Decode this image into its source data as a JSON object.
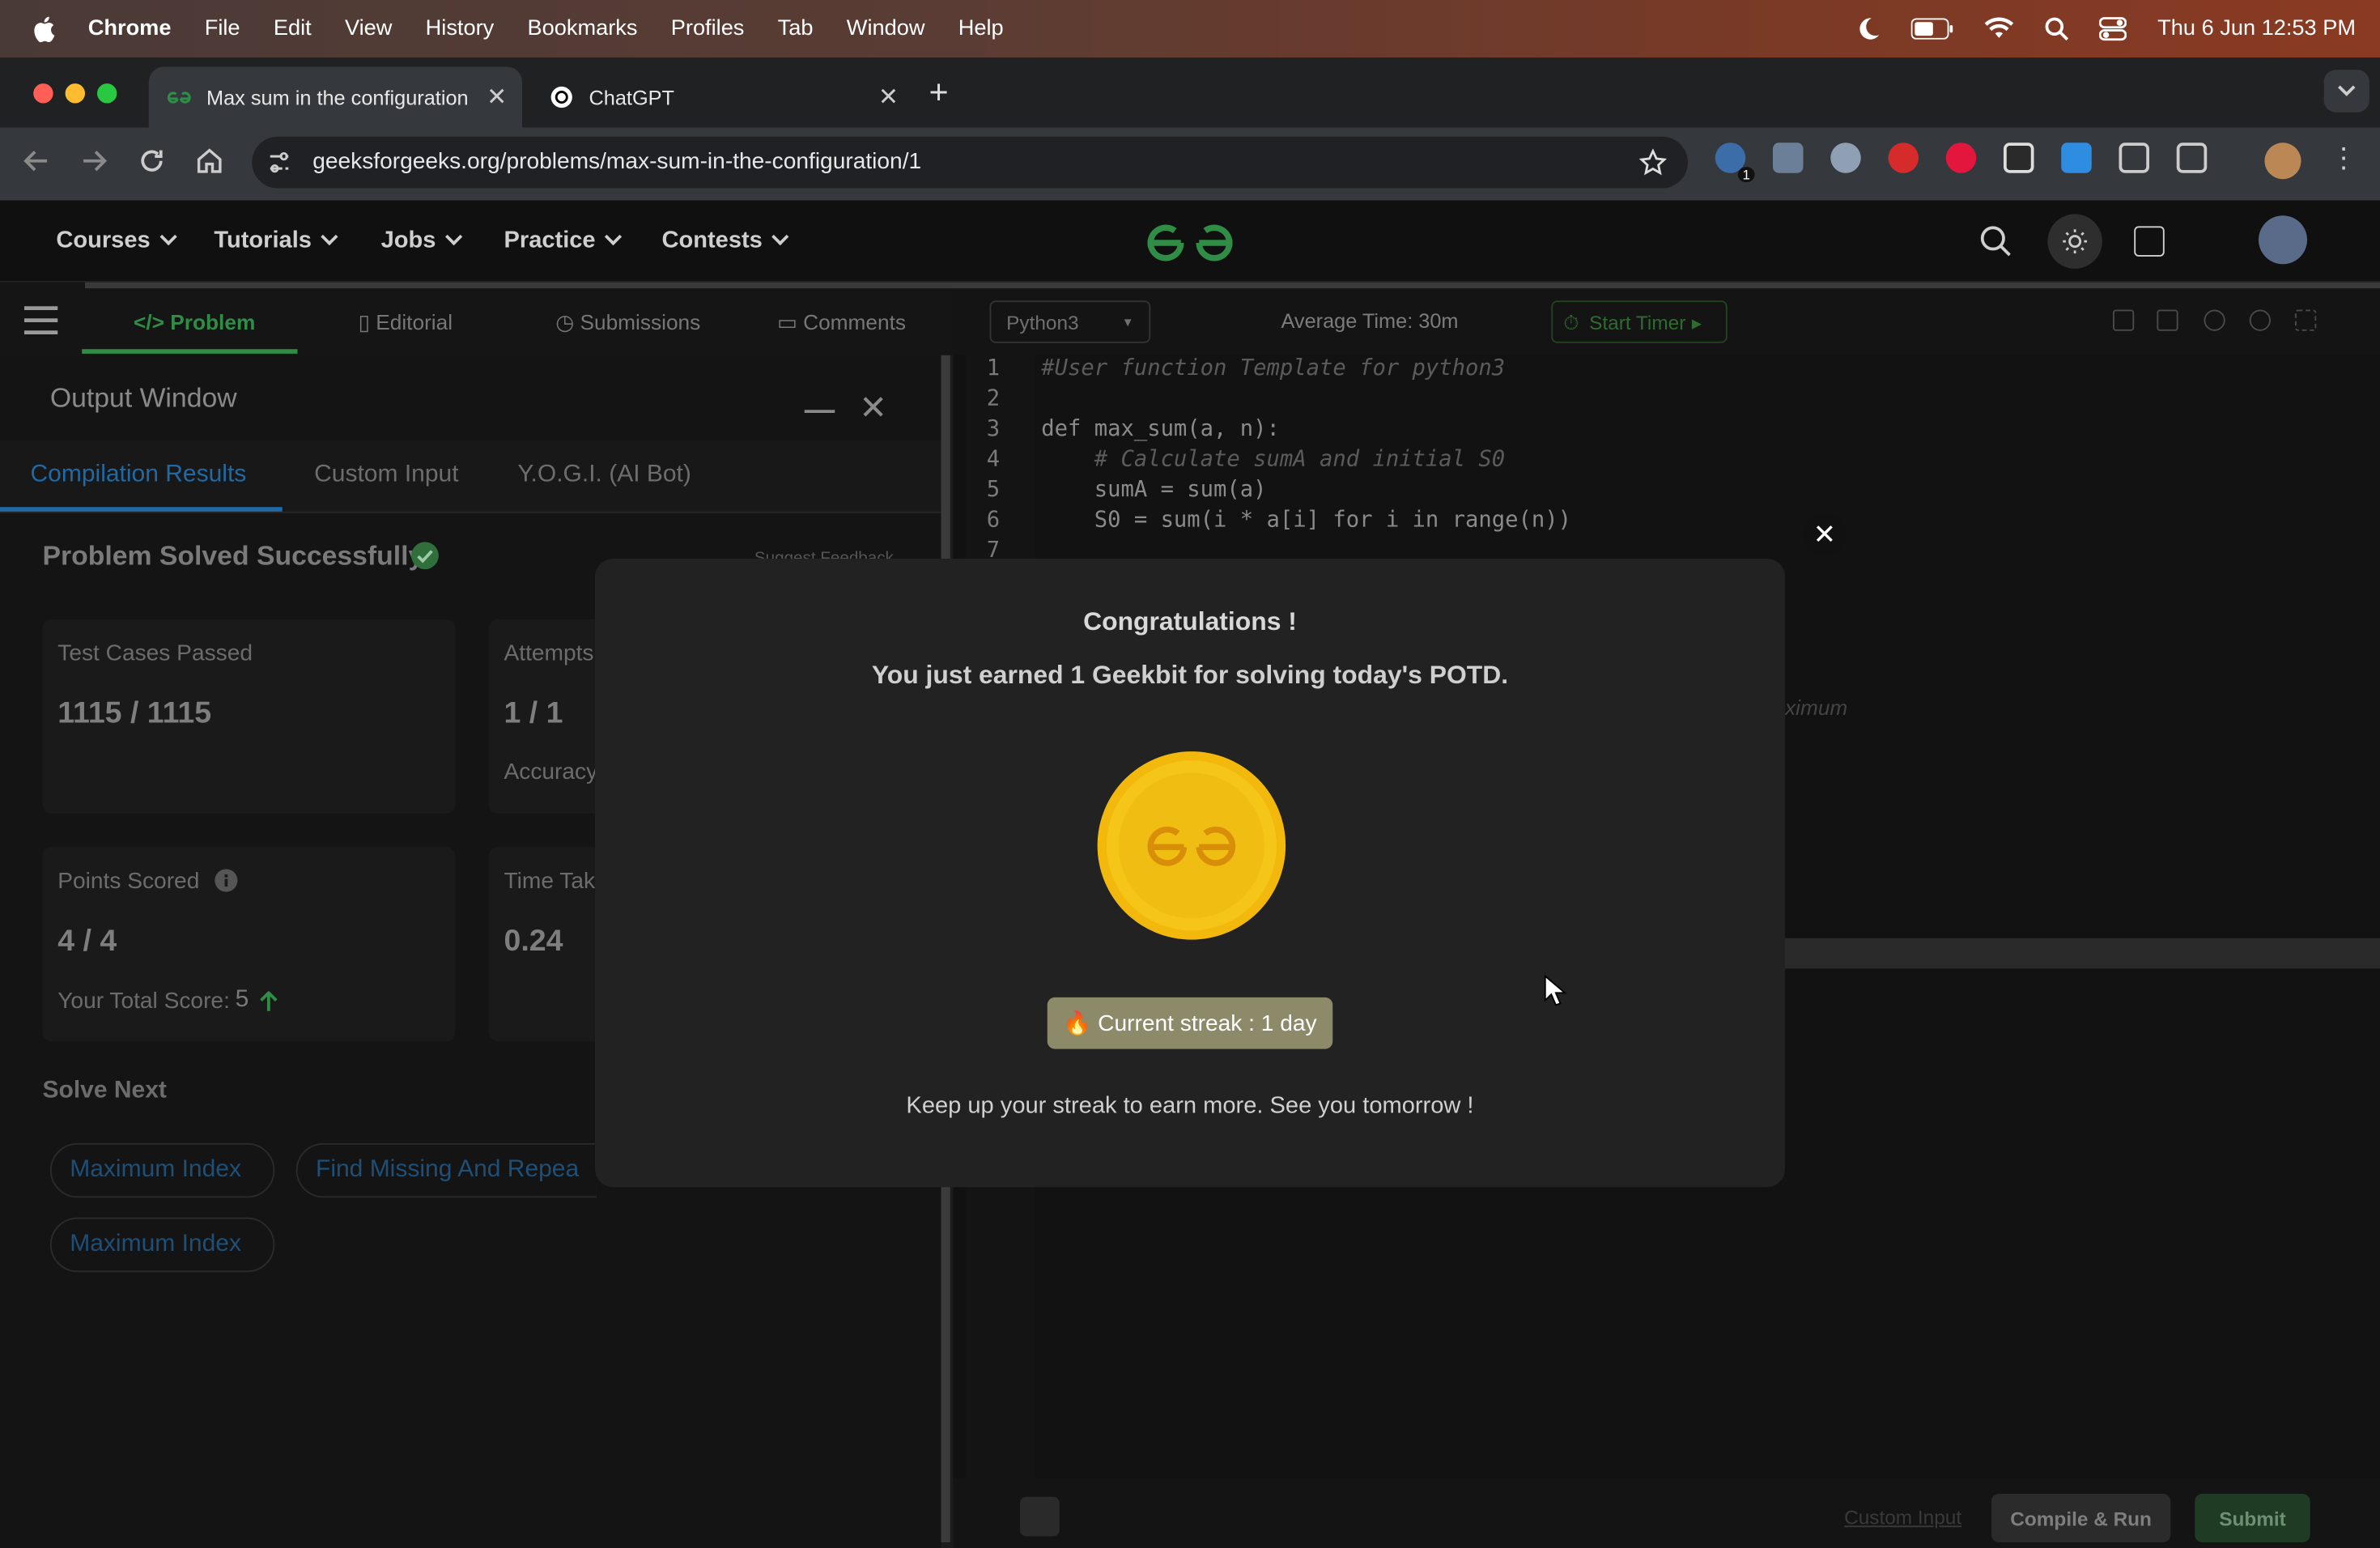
{
  "macbar": {
    "app": "Chrome",
    "menus": [
      "File",
      "Edit",
      "View",
      "History",
      "Bookmarks",
      "Profiles",
      "Tab",
      "Window",
      "Help"
    ],
    "datetime": "Thu 6 Jun  12:53 PM",
    "icons": [
      "apple-icon",
      "moon-icon",
      "battery-icon",
      "wifi-icon",
      "spotlight-icon",
      "control-center-icon"
    ]
  },
  "browser": {
    "tabs": [
      {
        "title": "Max sum in the configuration",
        "close": "✕"
      },
      {
        "title": "ChatGPT",
        "close": "✕"
      }
    ],
    "new_tab": "+",
    "url": "geeksforgeeks.org/problems/max-sum-in-the-configuration/1",
    "extension_badge": "1"
  },
  "gfg": {
    "nav": [
      "Courses",
      "Tutorials",
      "Jobs",
      "Practice",
      "Contests"
    ],
    "brand_color": "#2f8d46"
  },
  "problem_tabs": [
    "Problem",
    "Editorial",
    "Submissions",
    "Comments"
  ],
  "output": {
    "title": "Output Window",
    "tabs": [
      "Compilation Results",
      "Custom Input",
      "Y.O.G.I. (AI Bot)"
    ],
    "status": "Problem Solved Successfully",
    "suggest": "Suggest Feedback",
    "cards": {
      "test_label": "Test Cases Passed",
      "test_value": "1115 / 1115",
      "attempts_label": "Attempts",
      "attempts_value": "1 / 1",
      "accuracy_label": "Accuracy",
      "points_label": "Points Scored",
      "points_value": "4 / 4",
      "total_label": "Your Total Score:",
      "total_value": "5",
      "time_label": "Time Tak",
      "time_value": "0.24"
    },
    "solve_next_title": "Solve Next",
    "solve_next": [
      "Maximum Index",
      "Find Missing And Repea",
      "Maximum Index"
    ]
  },
  "editor": {
    "language": "Python3",
    "avg_time": "Average Time: 30m",
    "start_timer": "Start Timer",
    "line_numbers": [
      "1",
      "2",
      "3",
      "4",
      "5",
      "6",
      "7"
    ],
    "lines": [
      "#User function Template for python3",
      "",
      "def max_sum(a, n):",
      "    # Calculate sumA and initial S0",
      "    sumA = sum(a)",
      "    S0 = sum(i * a[i] for i in range(n))",
      ""
    ],
    "ghost_text": "ximum",
    "custom_input": "Custom Input",
    "compile_run": "Compile & Run",
    "submit": "Submit"
  },
  "modal": {
    "title": "Congratulations !",
    "message": "You just earned 1 Geekbit for solving today's POTD.",
    "streak": "🔥 Current streak : 1 day",
    "footer": "Keep up your streak to earn more. See you tomorrow !",
    "close": "✕",
    "coin_color": "#f5c518"
  }
}
